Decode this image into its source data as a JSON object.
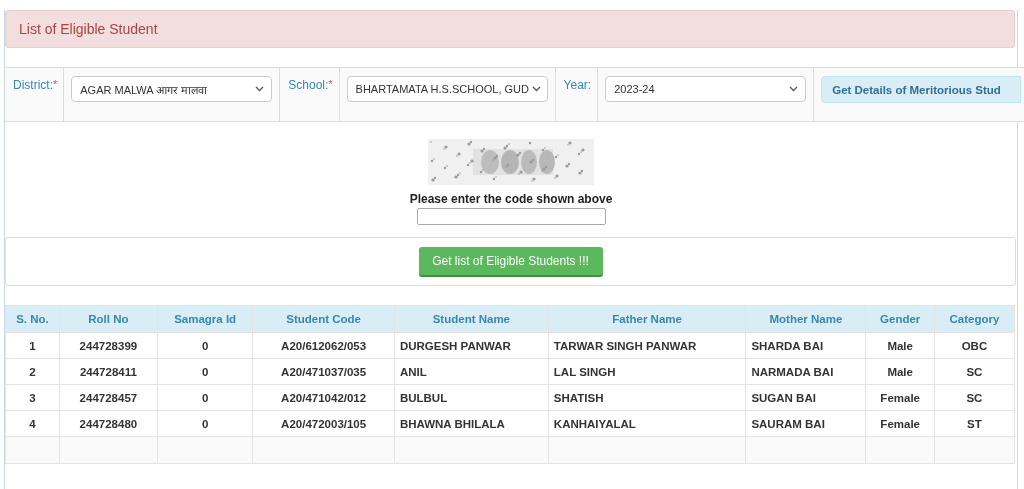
{
  "header": {
    "title": "List of Eligible Student"
  },
  "filters": [
    {
      "label": "District:",
      "required_mark": "*",
      "value": "AGAR MALWA आगर मालवा"
    },
    {
      "label": "School:",
      "required_mark": "*",
      "value": "BHARTAMATA H.S.SCHOOL, GUD"
    },
    {
      "label": "Year:",
      "value": "2023-24"
    }
  ],
  "details_button": "Get Details of Meritorious Stud",
  "captcha": {
    "prompt": "Please enter the code shown above"
  },
  "submit_button": "Get list of Eligible Students !!!",
  "table": {
    "columns": [
      "S. No.",
      "Roll No",
      "Samagra Id",
      "Student Code",
      "Student Name",
      "Father Name",
      "Mother Name",
      "Gender",
      "Category"
    ],
    "rows": [
      [
        "1",
        "244728399",
        "0",
        "A20/612062/053",
        "DURGESH PANWAR",
        "TARWAR SINGH PANWAR",
        "SHARDA BAI",
        "Male",
        "OBC"
      ],
      [
        "2",
        "244728411",
        "0",
        "A20/471037/035",
        "ANIL",
        "LAL SINGH",
        "NARMADA BAI",
        "Male",
        "SC"
      ],
      [
        "3",
        "244728457",
        "0",
        "A20/471042/012",
        "BULBUL",
        "SHATISH",
        "SUGAN BAI",
        "Female",
        "SC"
      ],
      [
        "4",
        "244728480",
        "0",
        "A20/472003/105",
        "BHAWNA BHILALA",
        "KANHAIYALAL",
        "SAURAM BAI",
        "Female",
        "ST"
      ]
    ]
  }
}
